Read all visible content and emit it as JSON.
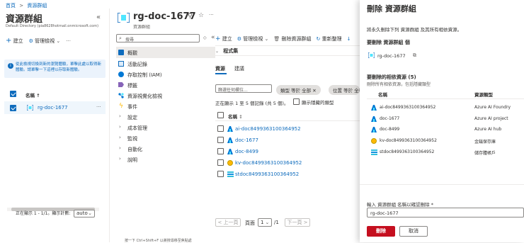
{
  "breadcrumb": {
    "home": "首頁",
    "sep": ">",
    "current": "資源群組"
  },
  "left": {
    "title": "資源群組",
    "subtitle": "Default Directory (pia8628hotmail.onmicrosoft.com)",
    "collapse": "«",
    "create": "建立",
    "manage_view": "管理檢視",
    "more": "···",
    "info": "從此檢視切換到新的瀏覽體驗，單擊此處以取得新體驗。請單擊一下這裡以存取新體驗。",
    "col_name": "名稱 ↑",
    "rows": [
      {
        "name": "rg-doc-1677",
        "more": "···"
      }
    ],
    "pager_text": "正在顯示 1 - 1/1。顯示計數:",
    "pager_select": "auto"
  },
  "rg": {
    "title": "rg-doc-1677",
    "subtitle": "資源群組",
    "search_placeholder": "搜尋",
    "nav": [
      {
        "label": "概觀",
        "icon": "overview-icon",
        "active": true
      },
      {
        "label": "活動記錄",
        "icon": "activity-log-icon"
      },
      {
        "label": "存取控制 (IAM)",
        "icon": "iam-icon"
      },
      {
        "label": "標籤",
        "icon": "tag-icon"
      },
      {
        "label": "資源視覺化檢視",
        "icon": "visualizer-icon"
      },
      {
        "label": "事件",
        "icon": "event-icon"
      },
      {
        "label": "設定",
        "expandable": true
      },
      {
        "label": "成本管理",
        "expandable": true
      },
      {
        "label": "監視",
        "expandable": true
      },
      {
        "label": "自動化",
        "expandable": true
      },
      {
        "label": "說明",
        "expandable": true
      }
    ],
    "toolbar": {
      "create": "建立",
      "manage_view": "管理檢視",
      "delete": "刪除資源群組",
      "refresh": "重新整理"
    },
    "essentials": "程式集",
    "tabs": [
      "資源",
      "建議"
    ],
    "filter_placeholder": "篩選任何欄位...",
    "filters": [
      "類型 等於 全部",
      "位置 等於 全部"
    ],
    "showing": "正在顯示 1 至 5 個記錄 (共 5 個)。",
    "show_hidden": "顯示隱藏的類型",
    "col_name": "名稱",
    "resources": [
      {
        "name": "ai-doc8499363100364952",
        "icon": "foundry-icon"
      },
      {
        "name": "doc-1677",
        "icon": "ai-project-icon"
      },
      {
        "name": "doc-8499",
        "icon": "ai-hub-icon"
      },
      {
        "name": "kv-doc8499363100364952",
        "icon": "key-vault-icon"
      },
      {
        "name": "stdoc8499363100364952",
        "icon": "storage-icon"
      }
    ],
    "prev": "< 上一頁",
    "page_label": "頁面",
    "page_value": "1",
    "page_total": "/1",
    "next": "下一頁 >",
    "hint": "按一下 Ctrl+Shift+F 以將搜尋移至焦點處"
  },
  "dialog": {
    "title": "刪除 資源群組",
    "desc": "將永久刪除下列 資源群組 及其所有相依資源。",
    "section1": "要刪除 資源群組 個",
    "rg_name": "rg-doc-1677",
    "section2": "要刪除的相依資源 (5)",
    "section2_sub": "刪除所有相依資源，包括隱藏類型",
    "col_name": "名稱",
    "col_type": "資源類型",
    "resources": [
      {
        "name": "ai-doc8499363100364952",
        "type": "Azure AI Foundry",
        "icon": "foundry-icon"
      },
      {
        "name": "doc-1677",
        "type": "Azure AI project",
        "icon": "ai-project-icon"
      },
      {
        "name": "doc-8499",
        "type": "Azure AI hub",
        "icon": "ai-hub-icon"
      },
      {
        "name": "kv-doc8499363100364952",
        "type": "金鑰保存庫",
        "icon": "key-vault-icon"
      },
      {
        "name": "stdoc8499363100364952",
        "type": "儲存體帳戶",
        "icon": "storage-icon"
      }
    ],
    "confirm_label": "輸入 資源群組 名稱以確認刪除 *",
    "confirm_value": "rg-doc-1677",
    "delete": "刪除",
    "cancel": "取消"
  }
}
